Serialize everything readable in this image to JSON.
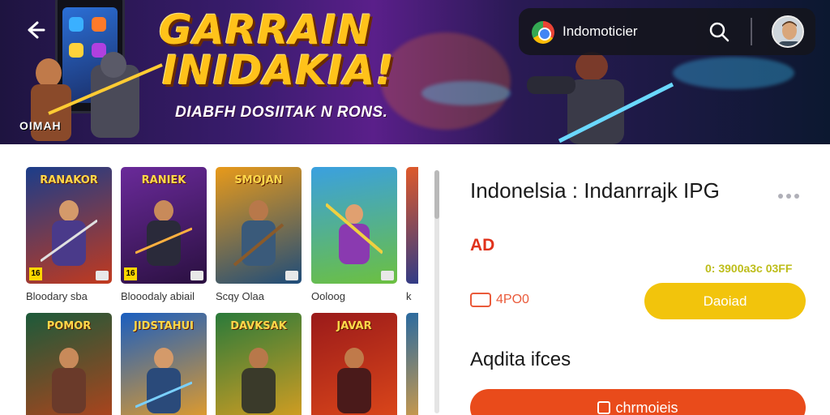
{
  "banner": {
    "title_line1": "GARRAIN",
    "title_line2": "INIDAKIA!",
    "subtitle": "DIABFH DOSIITAK N RONS.",
    "corner_label": "OIMAH"
  },
  "browser": {
    "url": "Indomoticier",
    "icons": [
      "back-arrow-icon",
      "chrome-icon",
      "search-icon",
      "avatar"
    ]
  },
  "grid": {
    "cards": [
      {
        "title": "RANAKOR",
        "name": "Bloodary sba",
        "age": "16",
        "colors": [
          "#1b3d8a",
          "#c23a1e"
        ]
      },
      {
        "title": "RANIEK",
        "name": "Blooodaly abiail",
        "age": "16",
        "colors": [
          "#6a2a9a",
          "#2a1040"
        ]
      },
      {
        "title": "SMOJAN",
        "name": "Scqy Olaa",
        "age": "",
        "colors": [
          "#e89a1a",
          "#1e4c7a"
        ]
      },
      {
        "title": "",
        "name": "Ooloog",
        "age": "",
        "colors": [
          "#3aa0e0",
          "#6cc040"
        ]
      },
      {
        "title": "POMOR",
        "name": "",
        "age": "",
        "colors": [
          "#1c5a3a",
          "#b8421a"
        ]
      },
      {
        "title": "JIDSTAHUI",
        "name": "",
        "age": "",
        "colors": [
          "#1a5ec0",
          "#f0a020"
        ]
      },
      {
        "title": "DAVKSAK",
        "name": "",
        "age": "",
        "colors": [
          "#2a7a3a",
          "#e0a020"
        ]
      },
      {
        "title": "JAVAR",
        "name": "",
        "age": "",
        "colors": [
          "#9a1a1a",
          "#e04a1a"
        ]
      }
    ],
    "partial_label": "k"
  },
  "detail": {
    "title": "Indonelsia : Indanrrajk IPG",
    "age_badge": "AD",
    "price": "0: 3900a3c 03FF",
    "rating": "4PO0",
    "download_label": "Daoiad",
    "section_title": "Aqdita ifces",
    "action_label": "chrmoieis"
  },
  "colors": {
    "accent_yellow": "#f2c40c",
    "accent_orange": "#e94b1b"
  }
}
